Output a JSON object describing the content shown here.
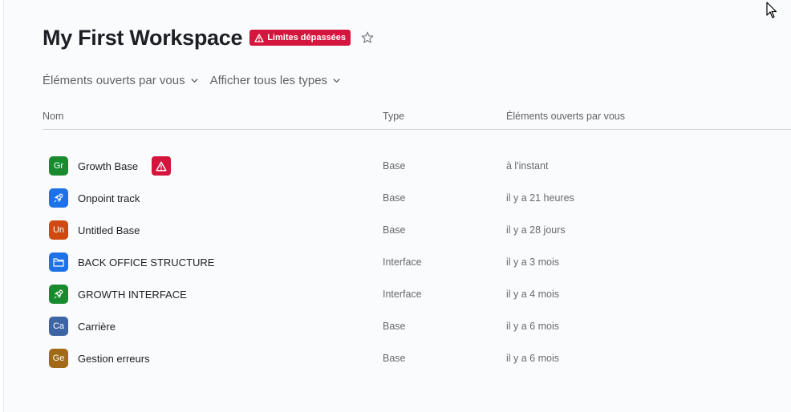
{
  "workspace": {
    "title": "My First Workspace",
    "limit_badge": "Limites dépassées"
  },
  "filters": {
    "opened": "Éléments ouverts par vous",
    "types": "Afficher tous les types"
  },
  "columns": {
    "name": "Nom",
    "type": "Type",
    "opened": "Éléments ouverts par vous"
  },
  "rows": [
    {
      "icon_text": "Gr",
      "icon": "text-badge",
      "color": "#1a8a2f",
      "name": "Growth Base",
      "type": "Base",
      "opened": "à l'instant",
      "warning": true
    },
    {
      "icon_text": "",
      "icon": "rocket-icon",
      "color": "#1d72e8",
      "name": "Onpoint track",
      "type": "Base",
      "opened": "il y a 21 heures"
    },
    {
      "icon_text": "Un",
      "icon": "text-badge",
      "color": "#cf4a10",
      "name": "Untitled Base",
      "type": "Base",
      "opened": "il y a 28 jours"
    },
    {
      "icon_text": "",
      "icon": "folder-icon",
      "color": "#1d72e8",
      "name": "BACK OFFICE STRUCTURE",
      "type": "Interface",
      "opened": "il y a 3 mois"
    },
    {
      "icon_text": "",
      "icon": "rocket-icon",
      "color": "#1a8a2f",
      "name": "GROWTH INTERFACE",
      "type": "Interface",
      "opened": "il y a 4 mois"
    },
    {
      "icon_text": "Ca",
      "icon": "text-badge",
      "color": "#3d64a3",
      "name": "Carrière",
      "type": "Base",
      "opened": "il y a 6 mois"
    },
    {
      "icon_text": "Ge",
      "icon": "text-badge",
      "color": "#a26a18",
      "name": "Gestion erreurs",
      "type": "Base",
      "opened": "il y a 6 mois"
    }
  ]
}
